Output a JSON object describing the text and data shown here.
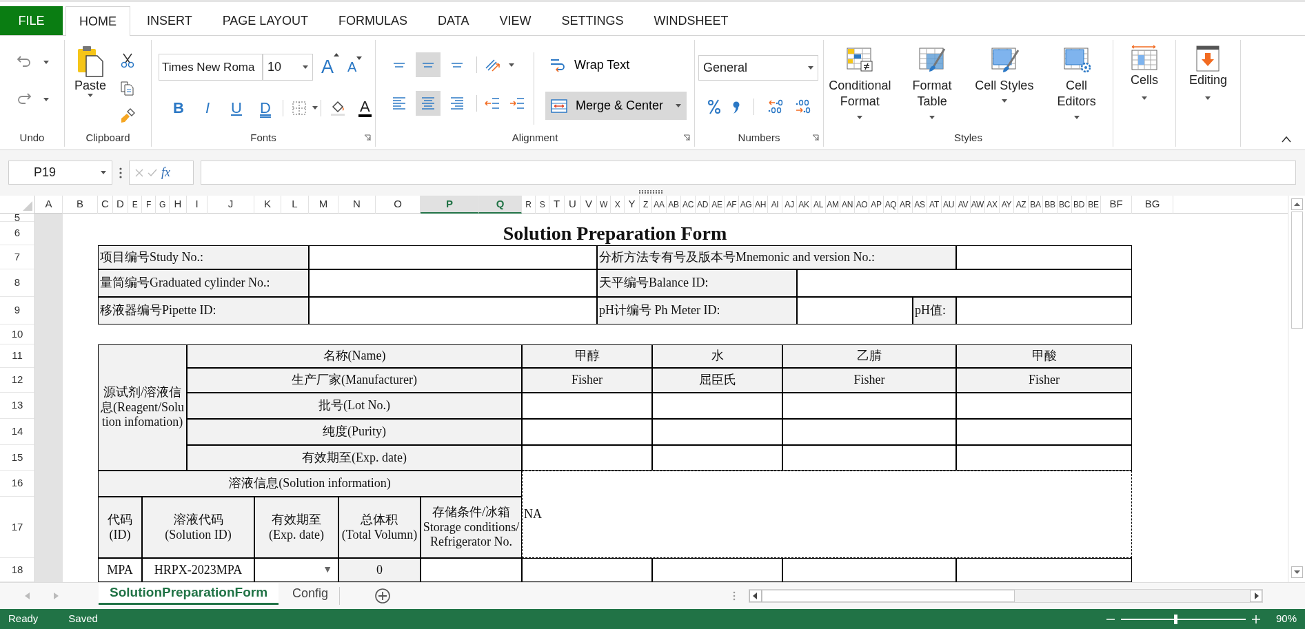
{
  "menu_tabs": [
    {
      "label": "FILE",
      "kind": "file",
      "selected": false
    },
    {
      "label": "HOME",
      "kind": "tab",
      "selected": true
    },
    {
      "label": "INSERT",
      "kind": "tab",
      "selected": false
    },
    {
      "label": "PAGE LAYOUT",
      "kind": "tab",
      "selected": false
    },
    {
      "label": "FORMULAS",
      "kind": "tab",
      "selected": false
    },
    {
      "label": "DATA",
      "kind": "tab",
      "selected": false
    },
    {
      "label": "VIEW",
      "kind": "tab",
      "selected": false
    },
    {
      "label": "SETTINGS",
      "kind": "tab",
      "selected": false
    },
    {
      "label": "WINDSHEET",
      "kind": "tab",
      "selected": false
    }
  ],
  "ribbon": {
    "undo": {
      "label": "Undo"
    },
    "clipboard": {
      "label": "Clipboard",
      "paste": "Paste"
    },
    "fonts": {
      "label": "Fonts",
      "font_name": "Times New Roma",
      "font_size": "10",
      "size_buttons": [
        {
          "kind": "grow",
          "label": "A"
        },
        {
          "kind": "shrink",
          "label": "A"
        }
      ],
      "style_buttons": [
        {
          "kind": "bold",
          "label": "B"
        },
        {
          "kind": "italic",
          "label": "I"
        },
        {
          "kind": "underline",
          "label": "U"
        },
        {
          "kind": "double_underline",
          "label": "D"
        }
      ],
      "font_color": "A"
    },
    "alignment": {
      "label": "Alignment",
      "vertical": [
        {
          "selected": false
        },
        {
          "selected": true
        },
        {
          "selected": false
        }
      ],
      "horizontal": [
        {
          "selected": false
        },
        {
          "selected": true
        },
        {
          "selected": false
        }
      ],
      "wrap_text": "Wrap Text",
      "merge": "Merge & Center"
    },
    "numbers": {
      "label": "Numbers",
      "format": "General"
    },
    "styles": {
      "label": "Styles",
      "buttons": [
        "Conditional Format",
        "Format Table",
        "Cell Styles",
        "Cell Editors"
      ]
    },
    "cells": "Cells",
    "editing": "Editing"
  },
  "formula_bar": {
    "name_box": "P19",
    "fx": "fx"
  },
  "columns": [
    {
      "label": "A",
      "selected": false
    },
    {
      "label": "B",
      "selected": false
    },
    {
      "label": "C",
      "selected": false
    },
    {
      "label": "D",
      "selected": false
    },
    {
      "label": "E",
      "selected": false
    },
    {
      "label": "F",
      "selected": false
    },
    {
      "label": "G",
      "selected": false
    },
    {
      "label": "H",
      "selected": false
    },
    {
      "label": "I",
      "selected": false
    },
    {
      "label": "J",
      "selected": false
    },
    {
      "label": "K",
      "selected": false
    },
    {
      "label": "L",
      "selected": false
    },
    {
      "label": "M",
      "selected": false
    },
    {
      "label": "N",
      "selected": false
    },
    {
      "label": "O",
      "selected": false
    },
    {
      "label": "P",
      "selected": true
    },
    {
      "label": "Q",
      "selected": true
    },
    {
      "label": "R",
      "selected": false
    },
    {
      "label": "S",
      "selected": false
    },
    {
      "label": "T",
      "selected": false
    },
    {
      "label": "U",
      "selected": false
    },
    {
      "label": "V",
      "selected": false
    },
    {
      "label": "W",
      "selected": false
    },
    {
      "label": "X",
      "selected": false
    },
    {
      "label": "Y",
      "selected": false
    },
    {
      "label": "Z",
      "selected": false
    },
    {
      "label": "AA",
      "selected": false
    },
    {
      "label": "AB",
      "selected": false
    },
    {
      "label": "AC",
      "selected": false
    },
    {
      "label": "AD",
      "selected": false
    },
    {
      "label": "AE",
      "selected": false
    },
    {
      "label": "AF",
      "selected": false
    },
    {
      "label": "AG",
      "selected": false
    },
    {
      "label": "AH",
      "selected": false
    },
    {
      "label": "AI",
      "selected": false
    },
    {
      "label": "AJ",
      "selected": false
    },
    {
      "label": "AK",
      "selected": false
    },
    {
      "label": "AL",
      "selected": false
    },
    {
      "label": "AM",
      "selected": false
    },
    {
      "label": "AN",
      "selected": false
    },
    {
      "label": "AO",
      "selected": false
    },
    {
      "label": "AP",
      "selected": false
    },
    {
      "label": "AQ",
      "selected": false
    },
    {
      "label": "AR",
      "selected": false
    },
    {
      "label": "AS",
      "selected": false
    },
    {
      "label": "AT",
      "selected": false
    },
    {
      "label": "AU",
      "selected": false
    },
    {
      "label": "AV",
      "selected": false
    },
    {
      "label": "AW",
      "selected": false
    },
    {
      "label": "AX",
      "selected": false
    },
    {
      "label": "AY",
      "selected": false
    },
    {
      "label": "AZ",
      "selected": false
    },
    {
      "label": "BA",
      "selected": false
    },
    {
      "label": "BB",
      "selected": false
    },
    {
      "label": "BC",
      "selected": false
    },
    {
      "label": "BD",
      "selected": false
    },
    {
      "label": "BE",
      "selected": false
    },
    {
      "label": "BF",
      "selected": false
    },
    {
      "label": "BG",
      "selected": false
    }
  ],
  "rows": [
    "5",
    "6",
    "7",
    "8",
    "9",
    "10",
    "11",
    "12",
    "13",
    "14",
    "15",
    "16",
    "17",
    "18"
  ],
  "form": {
    "cells": [
      "Solution Preparation Form",
      "项目编号Study No.:",
      "分析方法专有号及版本号Mnemonic and version No.:",
      "量筒编号Graduated cylinder No.:",
      "天平编号Balance ID:",
      "移液器编号Pipette ID:",
      "pH计编号 Ph Meter ID:",
      "pH值:",
      "源试剂/溶液信息(Reagent/Solution infomation)",
      "名称(Name)",
      "甲醇",
      "水",
      "乙腈",
      "甲酸",
      "生产厂家(Manufacturer)",
      "Fisher",
      "屈臣氏",
      "Fisher",
      "Fisher",
      "批号(Lot No.)",
      "纯度(Purity)",
      "有效期至(Exp. date)",
      "溶液信息(Solution information)",
      "NA",
      "代码\n(ID)",
      "溶液代码\n(Solution ID)",
      "有效期至\n(Exp. date)",
      "总体积\n(Total Volumn)",
      "存储条件/冰箱\nStorage conditions/\nRefrigerator No.",
      "MPA",
      "HRPX-2023MPA",
      "▼",
      "0"
    ]
  },
  "sheet_tabs": [
    {
      "label": "SolutionPreparationForm",
      "selected": true
    },
    {
      "label": "Config",
      "selected": false
    }
  ],
  "status_bar": {
    "ready": "Ready",
    "saved": "Saved",
    "zoom": "90%"
  },
  "zoom_slider": {
    "level": 0.44
  }
}
